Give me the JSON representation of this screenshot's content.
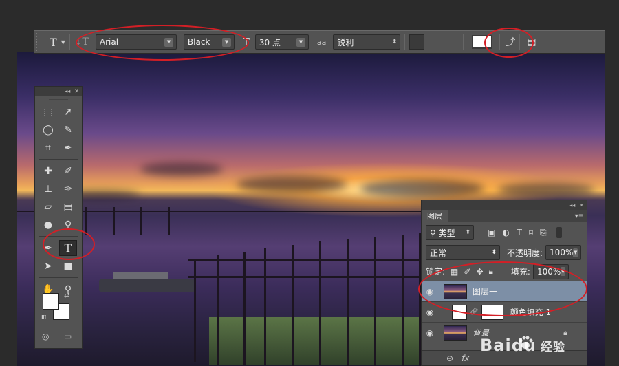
{
  "options_bar": {
    "tool_icon": "T",
    "orientation_icon": "text-orientation-icon",
    "font_family": "Arial",
    "font_style": "Black",
    "size_icon": "font-size-icon",
    "font_size": "30 点",
    "aa_icon": "aa",
    "antialias": "锐利",
    "text_color": "#ffffff",
    "warp_icon": "warp-text-icon",
    "panel_icon": "character-panel-icon"
  },
  "layers_panel": {
    "tab_title": "图层",
    "filter_label": "类型",
    "blend_mode": "正常",
    "opacity_label": "不透明度:",
    "opacity_value": "100%",
    "lock_label": "锁定:",
    "fill_label": "填充:",
    "fill_value": "100%",
    "layers": [
      {
        "name": "图层一",
        "selected": true
      },
      {
        "name": "颜色填充 1",
        "selected": false
      },
      {
        "name": "背景",
        "selected": false
      }
    ],
    "bottom_icons": [
      "link-icon",
      "fx"
    ]
  },
  "toolbox": {
    "type_tool": "T",
    "foreground_color": "#ffffff",
    "background_color": "#ffffff"
  },
  "watermark": {
    "brand": "Baidu",
    "suffix": "经验"
  },
  "accent": {
    "annotation_red": "#d31f26",
    "selection_blue": "#7d8fa6"
  }
}
